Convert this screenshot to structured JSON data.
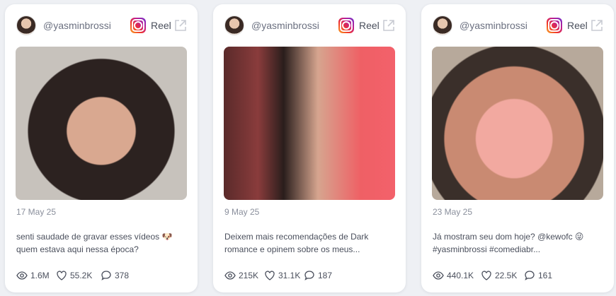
{
  "cards": [
    {
      "username": "@yasminbrossi",
      "type_label": "Reel",
      "date": "17 May 25",
      "caption_lines": [
        "senti saudade de gravar esses vídeos 🐶",
        "quem estava aqui nessa época?"
      ],
      "views": "1.6M",
      "likes": "55.2K",
      "comments": "378"
    },
    {
      "username": "@yasminbrossi",
      "type_label": "Reel",
      "date": "9 May 25",
      "caption_lines": [
        "Deixem mais recomendações de Dark",
        "romance e opinem sobre os meus..."
      ],
      "views": "215K",
      "likes": "31.1K",
      "comments": "187"
    },
    {
      "username": "@yasminbrossi",
      "type_label": "Reel",
      "date": "23 May 25",
      "caption_lines": [
        "Já mostram seu dom hoje? @kewofc 😜",
        "#yasminbrossi #comediabr..."
      ],
      "views": "440.1K",
      "likes": "22.5K",
      "comments": "161"
    }
  ],
  "icons": {
    "platform": "instagram-icon",
    "external": "external-link-icon",
    "views": "eye-icon",
    "likes": "heart-icon",
    "comments": "comment-icon"
  }
}
